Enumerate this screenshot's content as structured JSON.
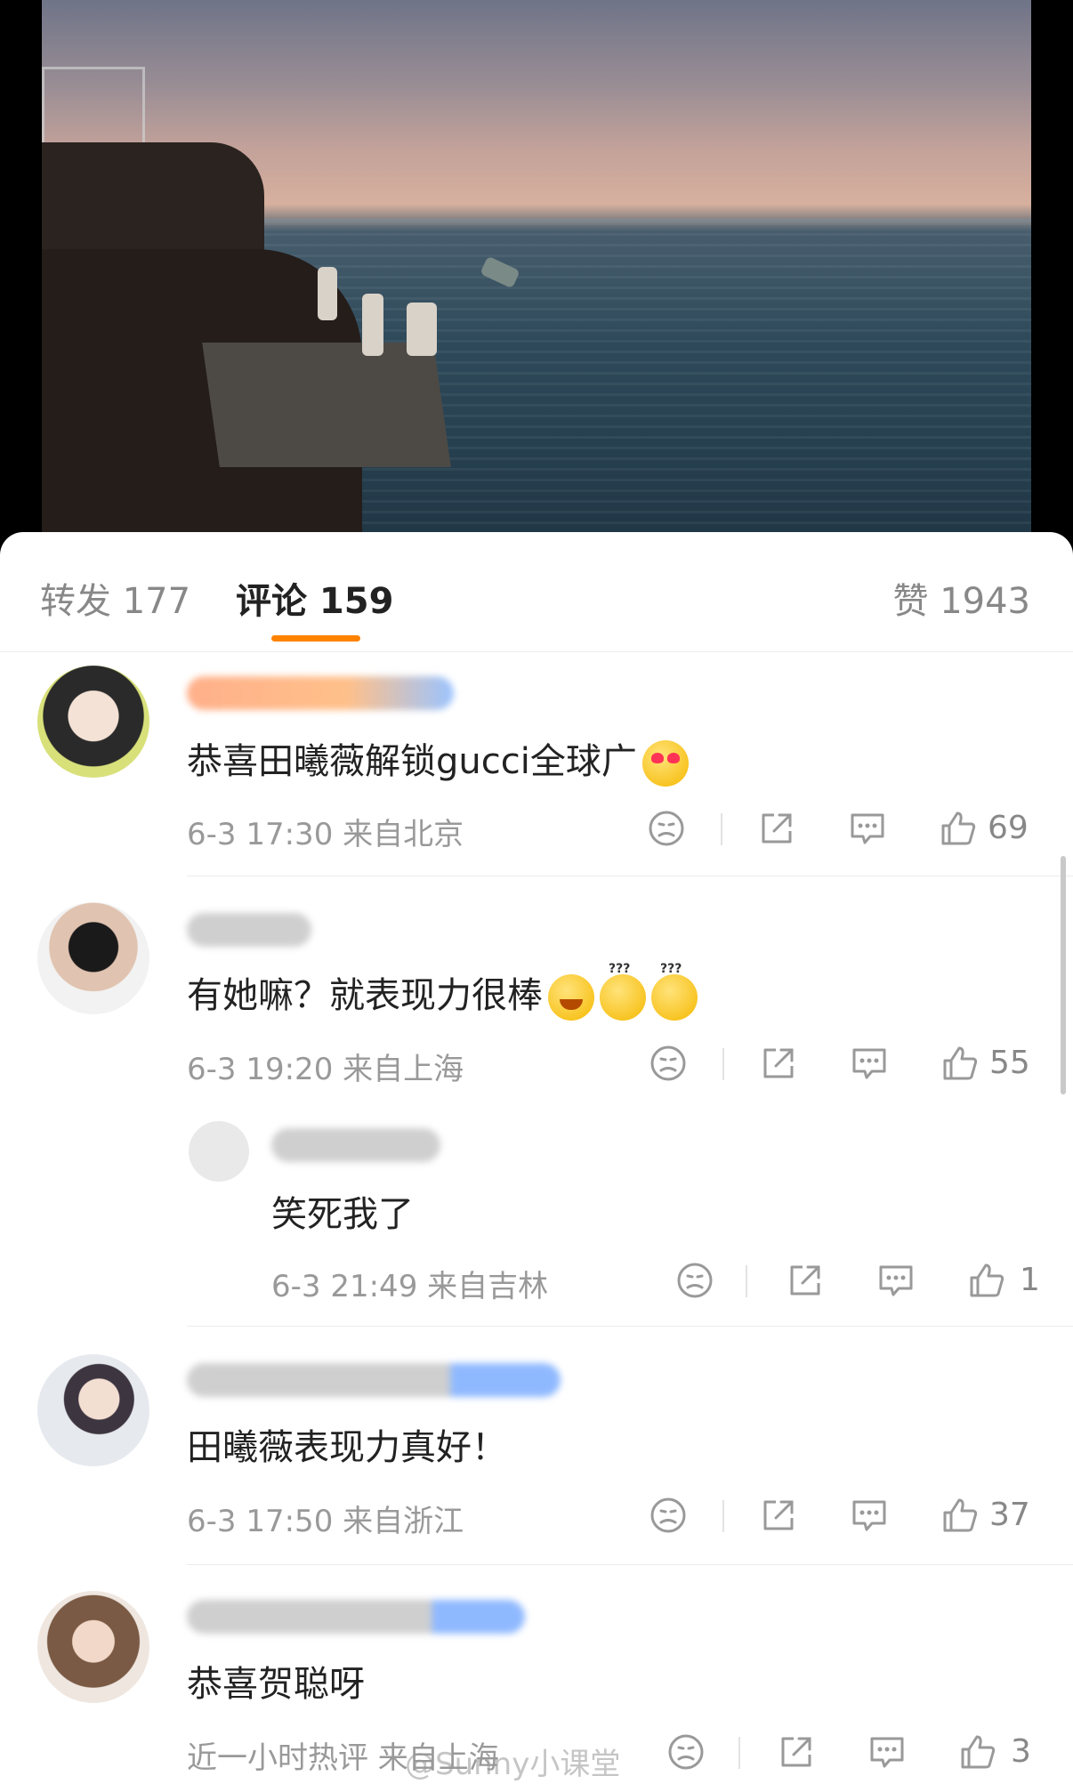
{
  "tabs": {
    "repost": "转发 177",
    "comment": "评论 159",
    "like": "赞 1943"
  },
  "comments": [
    {
      "text": "恭喜田曦薇解锁gucci全球广",
      "meta": "6-3 17:30 来自北京",
      "likes": "69"
    },
    {
      "text": "有她嘛？就表现力很棒",
      "meta": "6-3 19:20 来自上海",
      "likes": "55",
      "reply": {
        "text": "笑死我了",
        "meta": "6-3 21:49 来自吉林",
        "likes": "1"
      }
    },
    {
      "text": "田曦薇表现力真好！",
      "meta": "6-3 17:50 来自浙江",
      "likes": "37"
    },
    {
      "text": "恭喜贺聪呀",
      "meta": "近一小时热评 来自上海",
      "likes": "3"
    }
  ],
  "watermark": "@Sunny小课堂",
  "colors": {
    "accent": "#ff8200"
  }
}
